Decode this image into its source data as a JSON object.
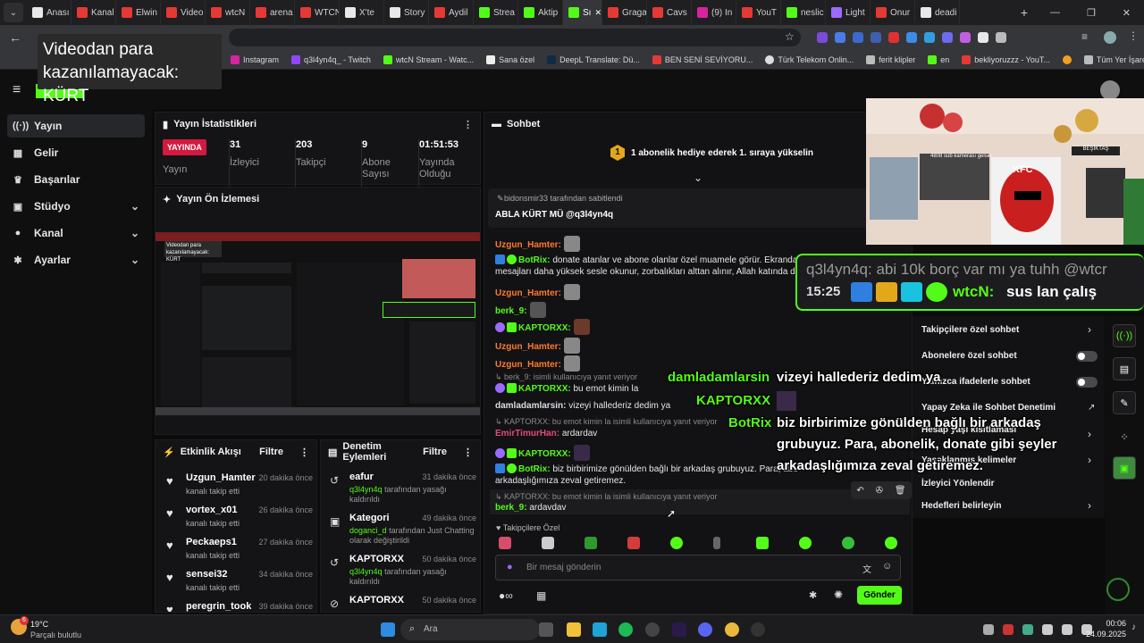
{
  "browser": {
    "tabs": [
      {
        "label": "Anası",
        "color": "#e8e8e8"
      },
      {
        "label": "Kanal",
        "color": "#e53935"
      },
      {
        "label": "Elwin",
        "color": "#e53935"
      },
      {
        "label": "Video",
        "color": "#e53935"
      },
      {
        "label": "wtcN",
        "color": "#e53935"
      },
      {
        "label": "arena",
        "color": "#e53935"
      },
      {
        "label": "WTCN",
        "color": "#e53935"
      },
      {
        "label": "X'te ",
        "color": "#e8e8e8"
      },
      {
        "label": "Story",
        "color": "#e8e8e8"
      },
      {
        "label": "Aydil",
        "color": "#e53935"
      },
      {
        "label": "Strea",
        "color": "#53fc18"
      },
      {
        "label": "Aktip",
        "color": "#53fc18"
      },
      {
        "label": "Sı",
        "color": "#53fc18"
      },
      {
        "label": "Graga",
        "color": "#e53935"
      },
      {
        "label": "Cavs",
        "color": "#e53935"
      },
      {
        "label": "(9) In",
        "color": "#d6249f"
      },
      {
        "label": "YouT",
        "color": "#e53935"
      },
      {
        "label": "neslic",
        "color": "#53fc18"
      },
      {
        "label": "Light",
        "color": "#9b6bff"
      },
      {
        "label": "Onur",
        "color": "#e53935"
      },
      {
        "label": "deadi",
        "color": "#e8e8e8"
      }
    ],
    "bookmarks": [
      "Instagram",
      "q3l4yn4q_ - Twitch",
      "wtcN Stream - Watc...",
      "Sana özel",
      "DeepL Translate: Dü...",
      "BEN SENİ SEVİYORU...",
      "Türk Telekom Onlin...",
      "ferit klipler",
      "en",
      "bekliyoruzzz - YouT...",
      "Tüm Yer İşaretleri"
    ]
  },
  "tooltip": {
    "text": "Videodan para kazanılamayacak: KÜRT"
  },
  "sidebar": {
    "items": [
      {
        "label": "Yayın",
        "icon": "broadcast-icon"
      },
      {
        "label": "Gelir",
        "icon": "wallet-icon"
      },
      {
        "label": "Başarılar",
        "icon": "trophy-icon"
      },
      {
        "label": "Stüdyo",
        "icon": "studio-icon"
      },
      {
        "label": "Kanal",
        "icon": "user-icon"
      },
      {
        "label": "Ayarlar",
        "icon": "gear-icon"
      }
    ]
  },
  "stats": {
    "title": "Yayın İstatistikleri",
    "live_badge": "YAYINDA",
    "live_label": "Yayın",
    "viewers": "31",
    "viewers_label": "İzleyici",
    "followers": "203",
    "followers_label": "Takipçi",
    "subs": "9",
    "subs_label": "Abone Sayısı",
    "duration": "01:51:53",
    "duration_label": "Yayında Olduğu"
  },
  "preview": {
    "title": "Yayın Ön İzlemesi",
    "overlay": "Videodan para kazanılamayacak: KÜRT"
  },
  "activity": {
    "title": "Etkinlik Akışı",
    "filter": "Filtre",
    "items": [
      {
        "name": "Uzgun_Hamter",
        "sub": "kanalı takip etti",
        "time": "20 dakika önce"
      },
      {
        "name": "vortex_x01",
        "sub": "kanalı takip etti",
        "time": "26 dakika önce"
      },
      {
        "name": "Peckaeps1",
        "sub": "kanalı takip etti",
        "time": "27 dakika önce"
      },
      {
        "name": "sensei32",
        "sub": "kanalı takip etti",
        "time": "34 dakika önce"
      },
      {
        "name": "peregrin_took",
        "sub": "",
        "time": "39 dakika önce"
      }
    ]
  },
  "moderation": {
    "title": "Denetim Eylemleri",
    "filter": "Filtre",
    "items": [
      {
        "name": "eafur",
        "who": "q3l4yn4q",
        "rest": "tarafından yasağı kaldırıldı",
        "time": "31 dakika önce"
      },
      {
        "name": "Kategori",
        "who": "doganci_d",
        "rest": "tarafından Just Chatting olarak değiştirildi",
        "time": "49 dakika önce"
      },
      {
        "name": "KAPTORXX",
        "who": "q3l4yn4q",
        "rest": "tarafından yasağı kaldırıldı",
        "time": "50 dakika önce"
      },
      {
        "name": "KAPTORXX",
        "who": "",
        "rest": "",
        "time": "50 dakika önce"
      }
    ]
  },
  "chat": {
    "title": "Sohbet",
    "gift_banner": "1 abonelik hediye ederek 1. sıraya yükselin",
    "gift_rank": "1",
    "pinned_by": "bidonsmir33 tarafından sabitlendi",
    "pinned_text": "ABLA KÜRT MÜ @q3l4yn4q",
    "messages": [
      {
        "user": "Uzgun_Hamter:",
        "text": "",
        "color": "o"
      },
      {
        "user": "BotRix:",
        "text": "donate atanlar ve abone olanlar özel muamele görür. Ekranda is",
        "color": "g"
      },
      {
        "user": "",
        "text": "mesajları daha yüksek sesle okunur, zorbalıkları alttan alınır, Allah katında daha",
        "color": "w"
      },
      {
        "user": "Uzgun_Hamter:",
        "text": "",
        "color": "o"
      },
      {
        "user": "berk_9:",
        "text": "",
        "color": "g"
      },
      {
        "user": "KAPTORXX:",
        "text": "",
        "color": "g"
      },
      {
        "user": "Uzgun_Hamter:",
        "text": "",
        "color": "o"
      },
      {
        "user": "Uzgun_Hamter:",
        "text": "",
        "color": "o"
      }
    ],
    "reply1": "berk_9: isimli kullanıcıya yanıt veriyor",
    "kaptor_emot": "bu emot kimin la",
    "damla_user": "damladamlarsin:",
    "damla_text": "vizeyi hallederiz dedim ya",
    "reply2": "KAPTORXX: bu emot kimin la isimli kullanıcıya yanıt veriyor",
    "emir_user": "EmirTimurHan:",
    "emir_text": "ardardav",
    "kaptor2": "KAPTORXX:",
    "botrix2": "BotRix:",
    "botrix2_text": "biz birbirimize gönülden bağlı bir arkadaş grubuyuz. Para, abo",
    "botrix2_text2": "arkadaşlığımıza zeval getiremez.",
    "reply3": "KAPTORXX: bu emot kimin la isimli kullanıcıya yanıt veriyor",
    "berk2_user": "berk_9:",
    "berk2_text": "ardavdav",
    "followers_only": "Takipçilere Özel",
    "input_placeholder": "Bir mesaj gönderin",
    "send": "Gönder"
  },
  "overlay": {
    "top_msg": "q3l4yn4q: abi 10k borç var mı ya tuhh @wtcr",
    "time": "15:25",
    "user": "wtcN:",
    "text": "sus lan çalış",
    "cam_caption": "4808 sub kamerası gelsin",
    "sign": "BEŞİKTAŞ",
    "hat": "KFC",
    "ov_damla": "damladamlarsin",
    "ov_damla_text": "vizeyi hallederiz dedim ya",
    "ov_kaptor": "KAPTORXX",
    "ov_botrix": "BotRix",
    "ov_botrix_l1": "biz birbirimize gönülden bağlı bir arkadaş",
    "ov_botrix_l2": "grubuyuz. Para, abonelik, donate gibi şeyler",
    "ov_botrix_l3": "arkadaşlığımıza zeval getiremez."
  },
  "chat_menu": {
    "items": [
      "Takipçilere özel sohbet",
      "Abonelere özel sohbet",
      "Yalnızca ifadelerle sohbet",
      "Yapay Zeka ile Sohbet Denetimi",
      "Hesap yaşı kısıtlaması",
      "Yasaklanmış kelimeler",
      "İzleyici Yönlendir",
      "Hedefleri belirleyin"
    ]
  },
  "taskbar": {
    "weather_temp": "19°C",
    "weather_desc": "Parçalı bulutlu",
    "weather_badge": "6",
    "search": "Ara",
    "time": "00:06",
    "date": "24.09.2025"
  }
}
